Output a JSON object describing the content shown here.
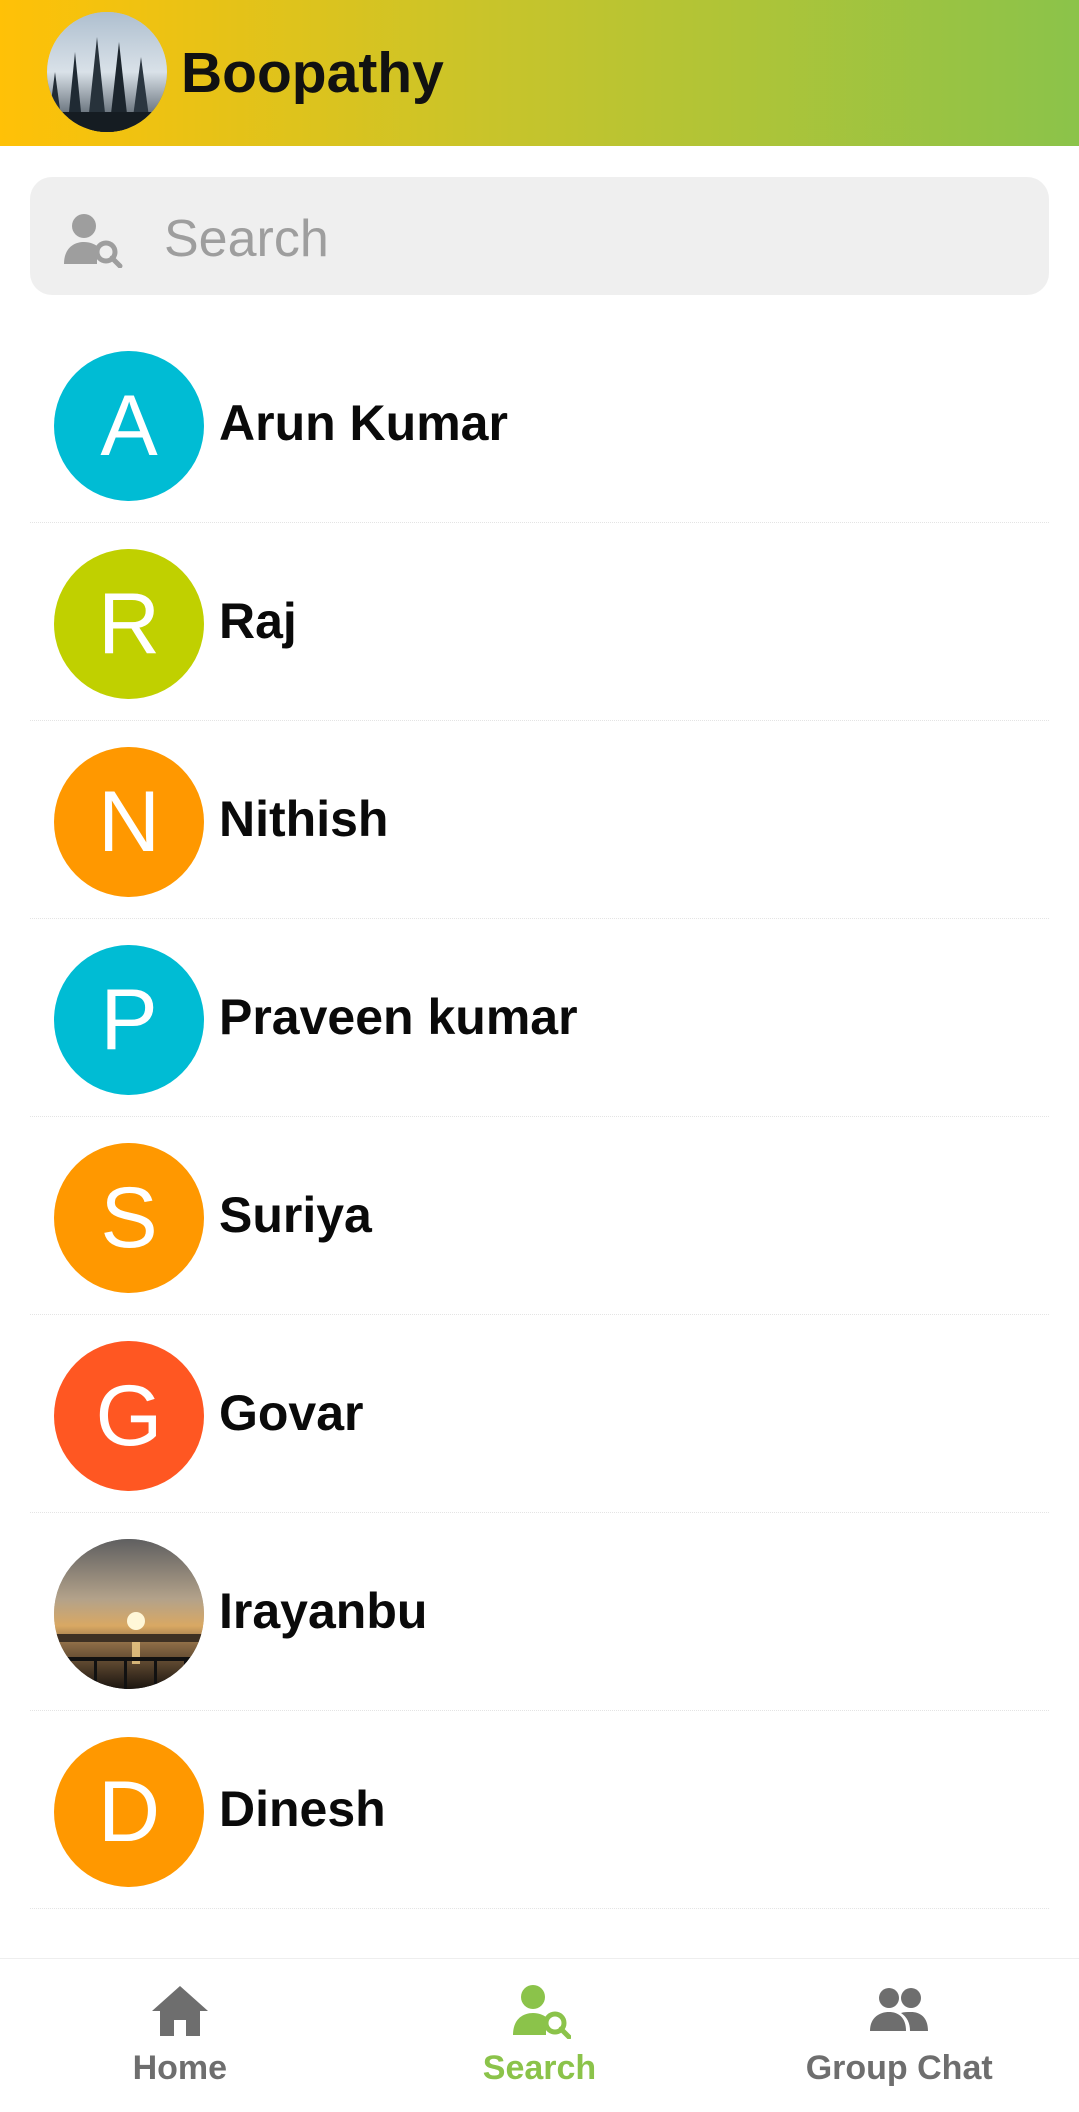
{
  "header": {
    "title": "Boopathy",
    "avatar_icon": "profile-photo"
  },
  "search": {
    "placeholder": "Search",
    "icon": "user-search-icon"
  },
  "contacts": [
    {
      "name": "Arun Kumar",
      "initial": "A",
      "color": "#00bcd4"
    },
    {
      "name": "Raj",
      "initial": "R",
      "color": "#c0d000"
    },
    {
      "name": "Nithish",
      "initial": "N",
      "color": "#ff9800"
    },
    {
      "name": "Praveen kumar",
      "initial": "P",
      "color": "#00bcd4"
    },
    {
      "name": "Suriya",
      "initial": "S",
      "color": "#ff9800"
    },
    {
      "name": "Govar",
      "initial": "G",
      "color": "#ff5722"
    },
    {
      "name": "Irayanbu",
      "initial": "",
      "color": "photo"
    },
    {
      "name": "Dinesh",
      "initial": "D",
      "color": "#ff9800"
    }
  ],
  "bottom_nav": {
    "items": [
      {
        "label": "Home",
        "icon": "home-icon",
        "active": false
      },
      {
        "label": "Search",
        "icon": "user-search-icon",
        "active": true
      },
      {
        "label": "Group Chat",
        "icon": "group-icon",
        "active": false
      }
    ],
    "active_color": "#8bc34a",
    "inactive_color": "#6e6e6e"
  }
}
